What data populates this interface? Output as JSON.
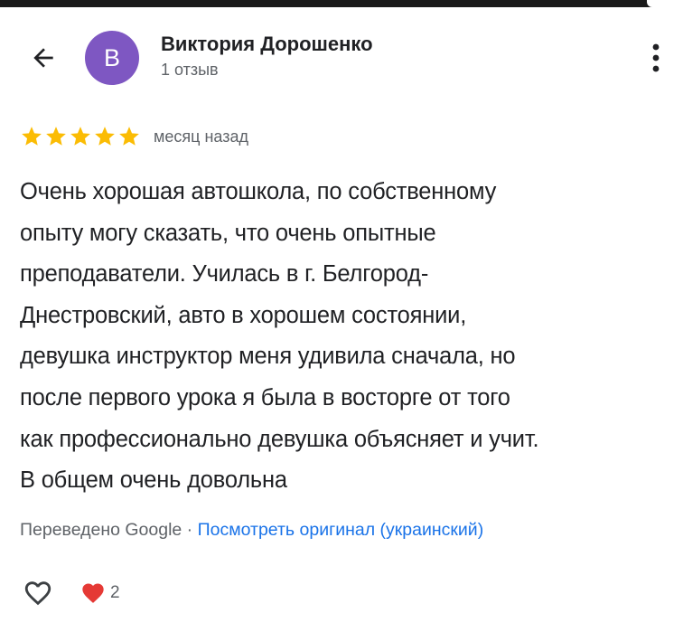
{
  "author": {
    "avatar_letter": "В",
    "avatar_color": "#7e57c2",
    "name": "Виктория Дорошенко",
    "meta": "1 отзыв"
  },
  "review": {
    "rating": 5,
    "max_rating": 5,
    "star_color": "#fbbc04",
    "date": "месяц назад",
    "lines": [
      "Очень хорошая автошкола, по собственному",
      "опыту могу сказать, что очень опытные",
      "преподаватели. Училась в г. Белгород-",
      "Днестровский, авто в хорошем состоянии,",
      "девушка инструктор меня удивила сначала, но",
      "после первого урока я была в восторге от того",
      "как профессионально девушка объясняет и учит.",
      "В общем очень довольна"
    ]
  },
  "translation": {
    "note": "Переведено Google",
    "separator": " · ",
    "link_text": "Посмотреть оригинал (украинский)",
    "link_color": "#1a73e8"
  },
  "actions": {
    "reaction_count": "2",
    "reaction_color": "#e53935"
  },
  "icons": {
    "back": "arrow-back-icon",
    "more": "more-vert-icon",
    "like": "heart-outline-icon",
    "reaction": "heart-filled-icon",
    "star": "star-icon"
  }
}
